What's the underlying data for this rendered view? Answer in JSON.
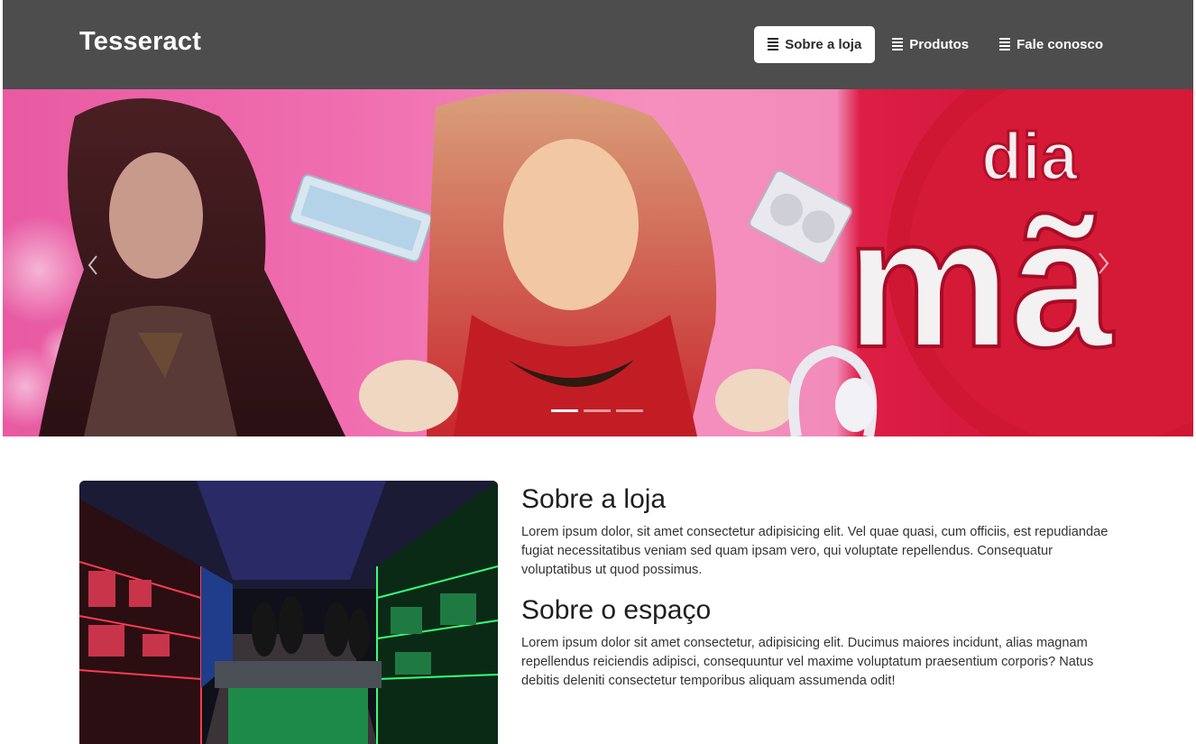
{
  "navbar": {
    "brand": "Tesseract",
    "links": [
      {
        "label": "Sobre a loja",
        "icon": "document-icon",
        "active": true
      },
      {
        "label": "Produtos",
        "icon": "document-icon",
        "active": false
      },
      {
        "label": "Fale conosco",
        "icon": "document-icon",
        "active": false
      }
    ]
  },
  "carousel": {
    "banner_text_top": "dia",
    "banner_text_bottom": "mã",
    "indicators": 3,
    "active_indicator": 1,
    "prev_icon": "chevron-left-icon",
    "next_icon": "chevron-right-icon"
  },
  "about": {
    "title1": "Sobre a loja",
    "body1": "Lorem ipsum dolor, sit amet consectetur adipisicing elit. Vel quae quasi, cum officiis, est repudiandae fugiat necessitatibus veniam sed quam ipsam vero, qui voluptate repellendus. Consequatur voluptatibus ut quod possimus.",
    "title2": "Sobre o espaço",
    "body2": "Lorem ipsum dolor sit amet consectetur, adipisicing elit. Ducimus maiores incidunt, alias magnam repellendus reiciendis adipisci, consequuntur vel maxime voluptatum praesentium corporis? Natus debitis deleniti consectetur temporibus aliquam assumenda odit!"
  },
  "colors": {
    "navbar_bg": "#4d4d4d",
    "banner_pink": "#f06fb0",
    "banner_red": "#c5112f"
  }
}
